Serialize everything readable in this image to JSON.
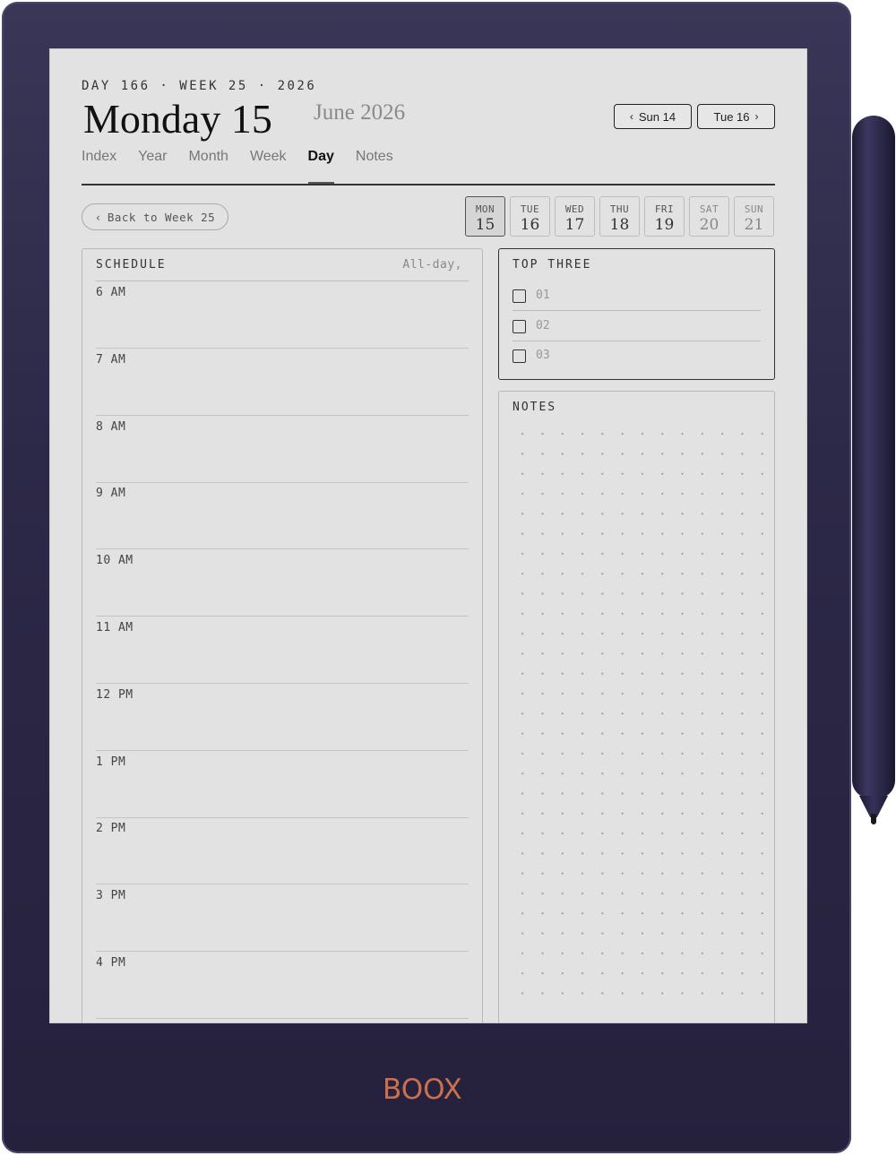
{
  "brand": "BOOX",
  "header": {
    "meta": "DAY 166 · WEEK 25 · 2026",
    "title": "Monday 15",
    "subtitle": "June 2026",
    "prev_chevron": "‹",
    "prev_label": "Sun 14",
    "next_label": "Tue 16",
    "next_chevron": "›"
  },
  "tabs": [
    {
      "label": "Index"
    },
    {
      "label": "Year"
    },
    {
      "label": "Month"
    },
    {
      "label": "Week"
    },
    {
      "label": "Day",
      "active": true
    },
    {
      "label": "Notes"
    }
  ],
  "back_button": {
    "chevron": "‹",
    "label": "Back to Week 25"
  },
  "week_days": [
    {
      "name": "MON",
      "date": "15",
      "active": true
    },
    {
      "name": "TUE",
      "date": "16"
    },
    {
      "name": "WED",
      "date": "17"
    },
    {
      "name": "THU",
      "date": "18"
    },
    {
      "name": "FRI",
      "date": "19"
    },
    {
      "name": "SAT",
      "date": "20"
    },
    {
      "name": "SUN",
      "date": "21"
    }
  ],
  "schedule": {
    "title": "SCHEDULE",
    "all_day": "All-day,",
    "hours": [
      "6 AM",
      "7 AM",
      "8 AM",
      "9 AM",
      "10 AM",
      "11 AM",
      "12 PM",
      "1 PM",
      "2 PM",
      "3 PM",
      "4 PM"
    ]
  },
  "top_three": {
    "title": "TOP THREE",
    "items": [
      "01",
      "02",
      "03"
    ]
  },
  "notes": {
    "title": "NOTES"
  }
}
